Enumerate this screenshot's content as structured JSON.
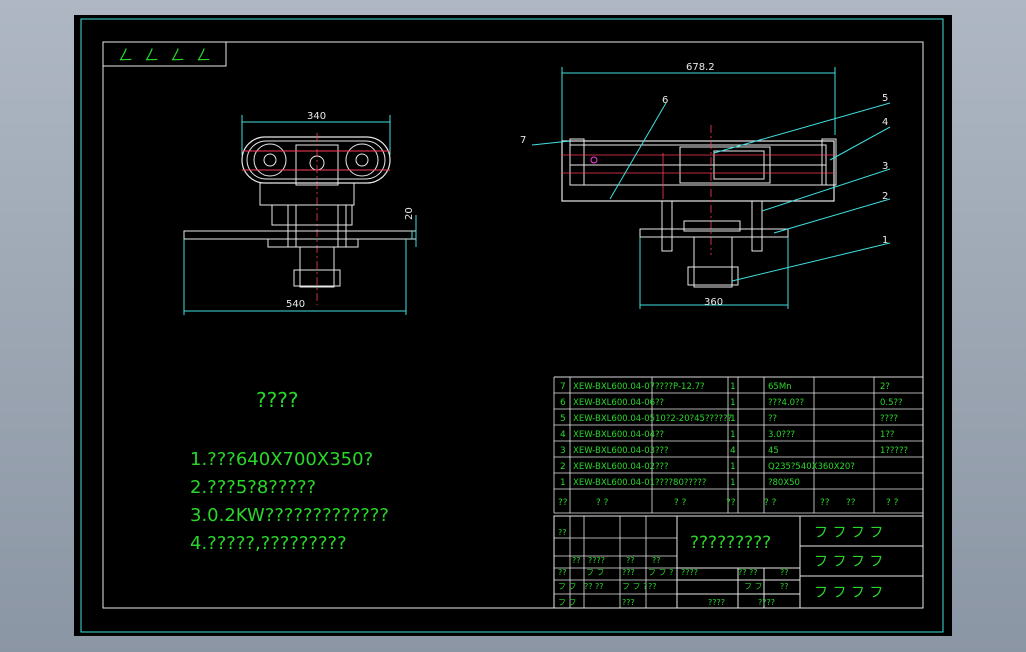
{
  "title_block_corner": [
    "ㄥ",
    "ㄥ",
    "ㄥ",
    "ㄥ"
  ],
  "left_view": {
    "dim_width_top": "340",
    "dim_height": "20",
    "dim_width_base": "540"
  },
  "right_view": {
    "dim_width_top": "678.2",
    "dim_width_base": "360",
    "callouts": [
      "1",
      "2",
      "3",
      "4",
      "5",
      "6",
      "7"
    ]
  },
  "notes": {
    "heading": "????",
    "lines": [
      "1.???640X700X350?",
      "2.???5?8?????",
      "3.0.2KW?????????????",
      "4.?????,?????????"
    ]
  },
  "bom": {
    "rows": [
      {
        "no": "7",
        "code": "XEW-BXL600.04-07",
        "name": "????P-12.7?",
        "qty": "1",
        "material": "65Mn",
        "note": "2?"
      },
      {
        "no": "6",
        "code": "XEW-BXL600.04-06",
        "name": "??",
        "qty": "1",
        "material": "???4.0??",
        "note": "0.5??"
      },
      {
        "no": "5",
        "code": "XEW-BXL600.04-05",
        "name": "10?2-20?45??????",
        "qty": "1",
        "material": "??",
        "note": "????"
      },
      {
        "no": "4",
        "code": "XEW-BXL600.04-04",
        "name": "??",
        "qty": "1",
        "material": "3.0???",
        "note": "1??"
      },
      {
        "no": "3",
        "code": "XEW-BXL600.04-03",
        "name": "???",
        "qty": "4",
        "material": "45",
        "note": "1?????"
      },
      {
        "no": "2",
        "code": "XEW-BXL600.04-02",
        "name": "???",
        "qty": "1",
        "material": "Q235?540X360X20?",
        "note": ""
      },
      {
        "no": "1",
        "code": "XEW-BXL600.04-01",
        "name": "????80?????",
        "qty": "1",
        "material": "?80X50",
        "note": ""
      }
    ],
    "header": [
      "??",
      "?  ?",
      "?  ?",
      "??",
      "?  ?",
      "??",
      "??",
      "?  ?"
    ],
    "drawing_title": "?????????",
    "title_right": [
      "フ  フ  フ  フ",
      "フ  フ  フ  フ",
      "フ  フ  フ  フ"
    ],
    "block_cells": [
      "??",
      "??",
      "????",
      "??",
      "??",
      "??",
      "フ フ",
      "???",
      "フ フ ?",
      "????",
      "?? ??",
      "??",
      "フ フ",
      "?? ??",
      "フ フ ?",
      "??",
      "フ フ",
      "??",
      "フ フ",
      "???",
      "????",
      "????"
    ]
  }
}
